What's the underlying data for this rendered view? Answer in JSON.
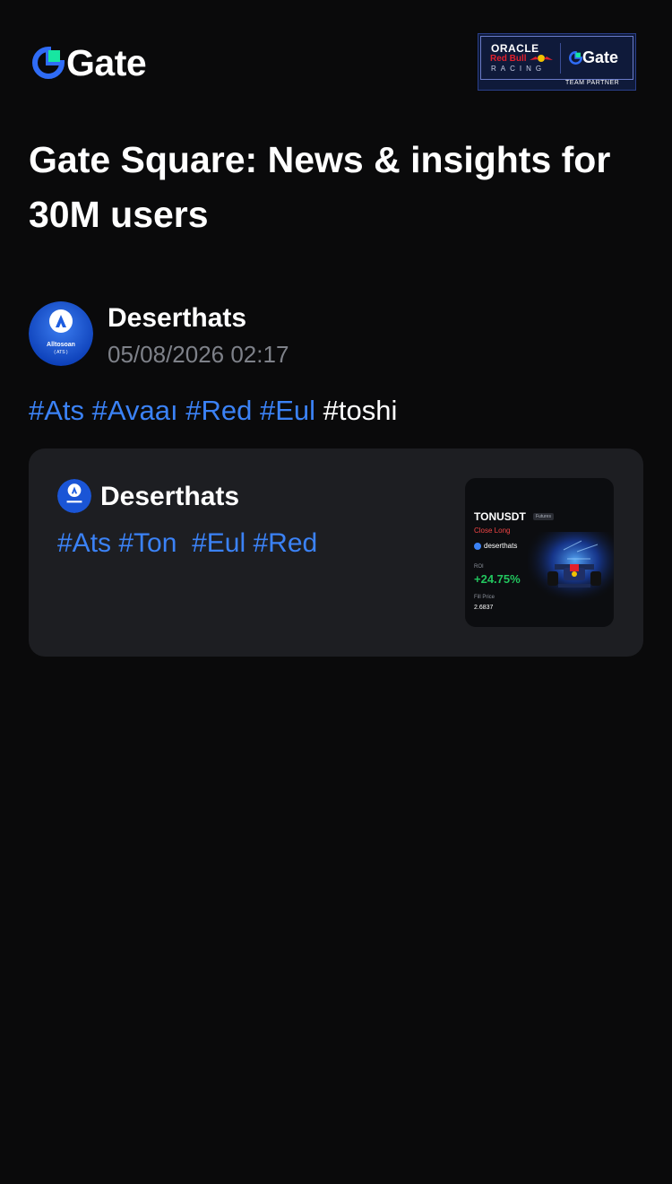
{
  "brand": {
    "name": "Gate",
    "logo_icon": "gate-logo-icon",
    "accent_color": "#3b82f6"
  },
  "partner_badge": {
    "line1": "ORACLE",
    "line2": "Red Bull",
    "line3": "RACING",
    "gate_text": "Gate",
    "tag": "TEAM PARTNER"
  },
  "title": "Gate Square: News & insights for 30M users",
  "post": {
    "author": "Deserthats",
    "avatar_icon": "avatar-logo",
    "avatar_text": "Alltosoan",
    "avatar_subtext": "( ATS )",
    "timestamp": "05/08/2026 02:17",
    "tags": [
      {
        "text": "#Ats",
        "is_link": true
      },
      {
        "text": "#Avaaı",
        "is_link": true
      },
      {
        "text": "#Red",
        "is_link": true
      },
      {
        "text": "#Eul",
        "is_link": true
      },
      {
        "text": "#toshi",
        "is_link": false
      }
    ]
  },
  "quoted_card": {
    "author": "Deserthats",
    "tags_line": "#Ats #Ton  #Eul #Red",
    "thumbnail": {
      "pair": "TONUSDT",
      "badge": "Futures",
      "side": "Close Long",
      "user": "deserthats",
      "roi_label": "ROI",
      "roi_value": "+24.75%",
      "fill_label": "Fill Price",
      "fill_value": "2.6837",
      "image_icon": "race-car-icon"
    }
  }
}
